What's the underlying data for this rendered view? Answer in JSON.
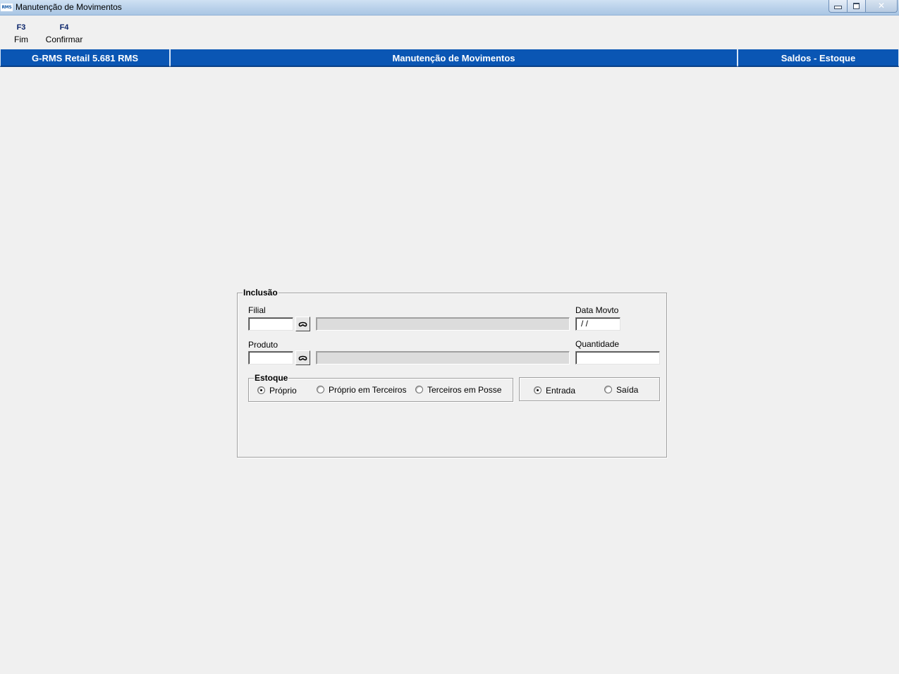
{
  "window": {
    "title": "Manutenção de Movimentos",
    "logo_text": "RMS",
    "controls": {
      "minimize": "minimize-icon",
      "maximize": "maximize-icon",
      "close": "close-icon"
    }
  },
  "toolbar": {
    "keys": [
      {
        "key": "F3",
        "label": "Fim"
      },
      {
        "key": "F4",
        "label": "Confirmar"
      }
    ]
  },
  "header": {
    "left": "G-RMS Retail 5.681 RMS",
    "center": "Manutenção de Movimentos",
    "right": "Saldos - Estoque"
  },
  "form": {
    "group_title": "Inclusão",
    "filial": {
      "label": "Filial",
      "value": "",
      "description": "",
      "lookup_icon": "binoculars-icon"
    },
    "data_movto": {
      "label": "Data Movto",
      "value": "/ /"
    },
    "produto": {
      "label": "Produto",
      "value": "",
      "description": "",
      "lookup_icon": "binoculars-icon"
    },
    "quantidade": {
      "label": "Quantidade",
      "value": ""
    },
    "estoque": {
      "title": "Estoque",
      "options": [
        "Próprio",
        "Próprio em Terceiros",
        "Terceiros em Posse"
      ],
      "selected": "Próprio"
    },
    "tipo": {
      "options": [
        "Entrada",
        "Saída"
      ],
      "selected": "Entrada"
    }
  }
}
